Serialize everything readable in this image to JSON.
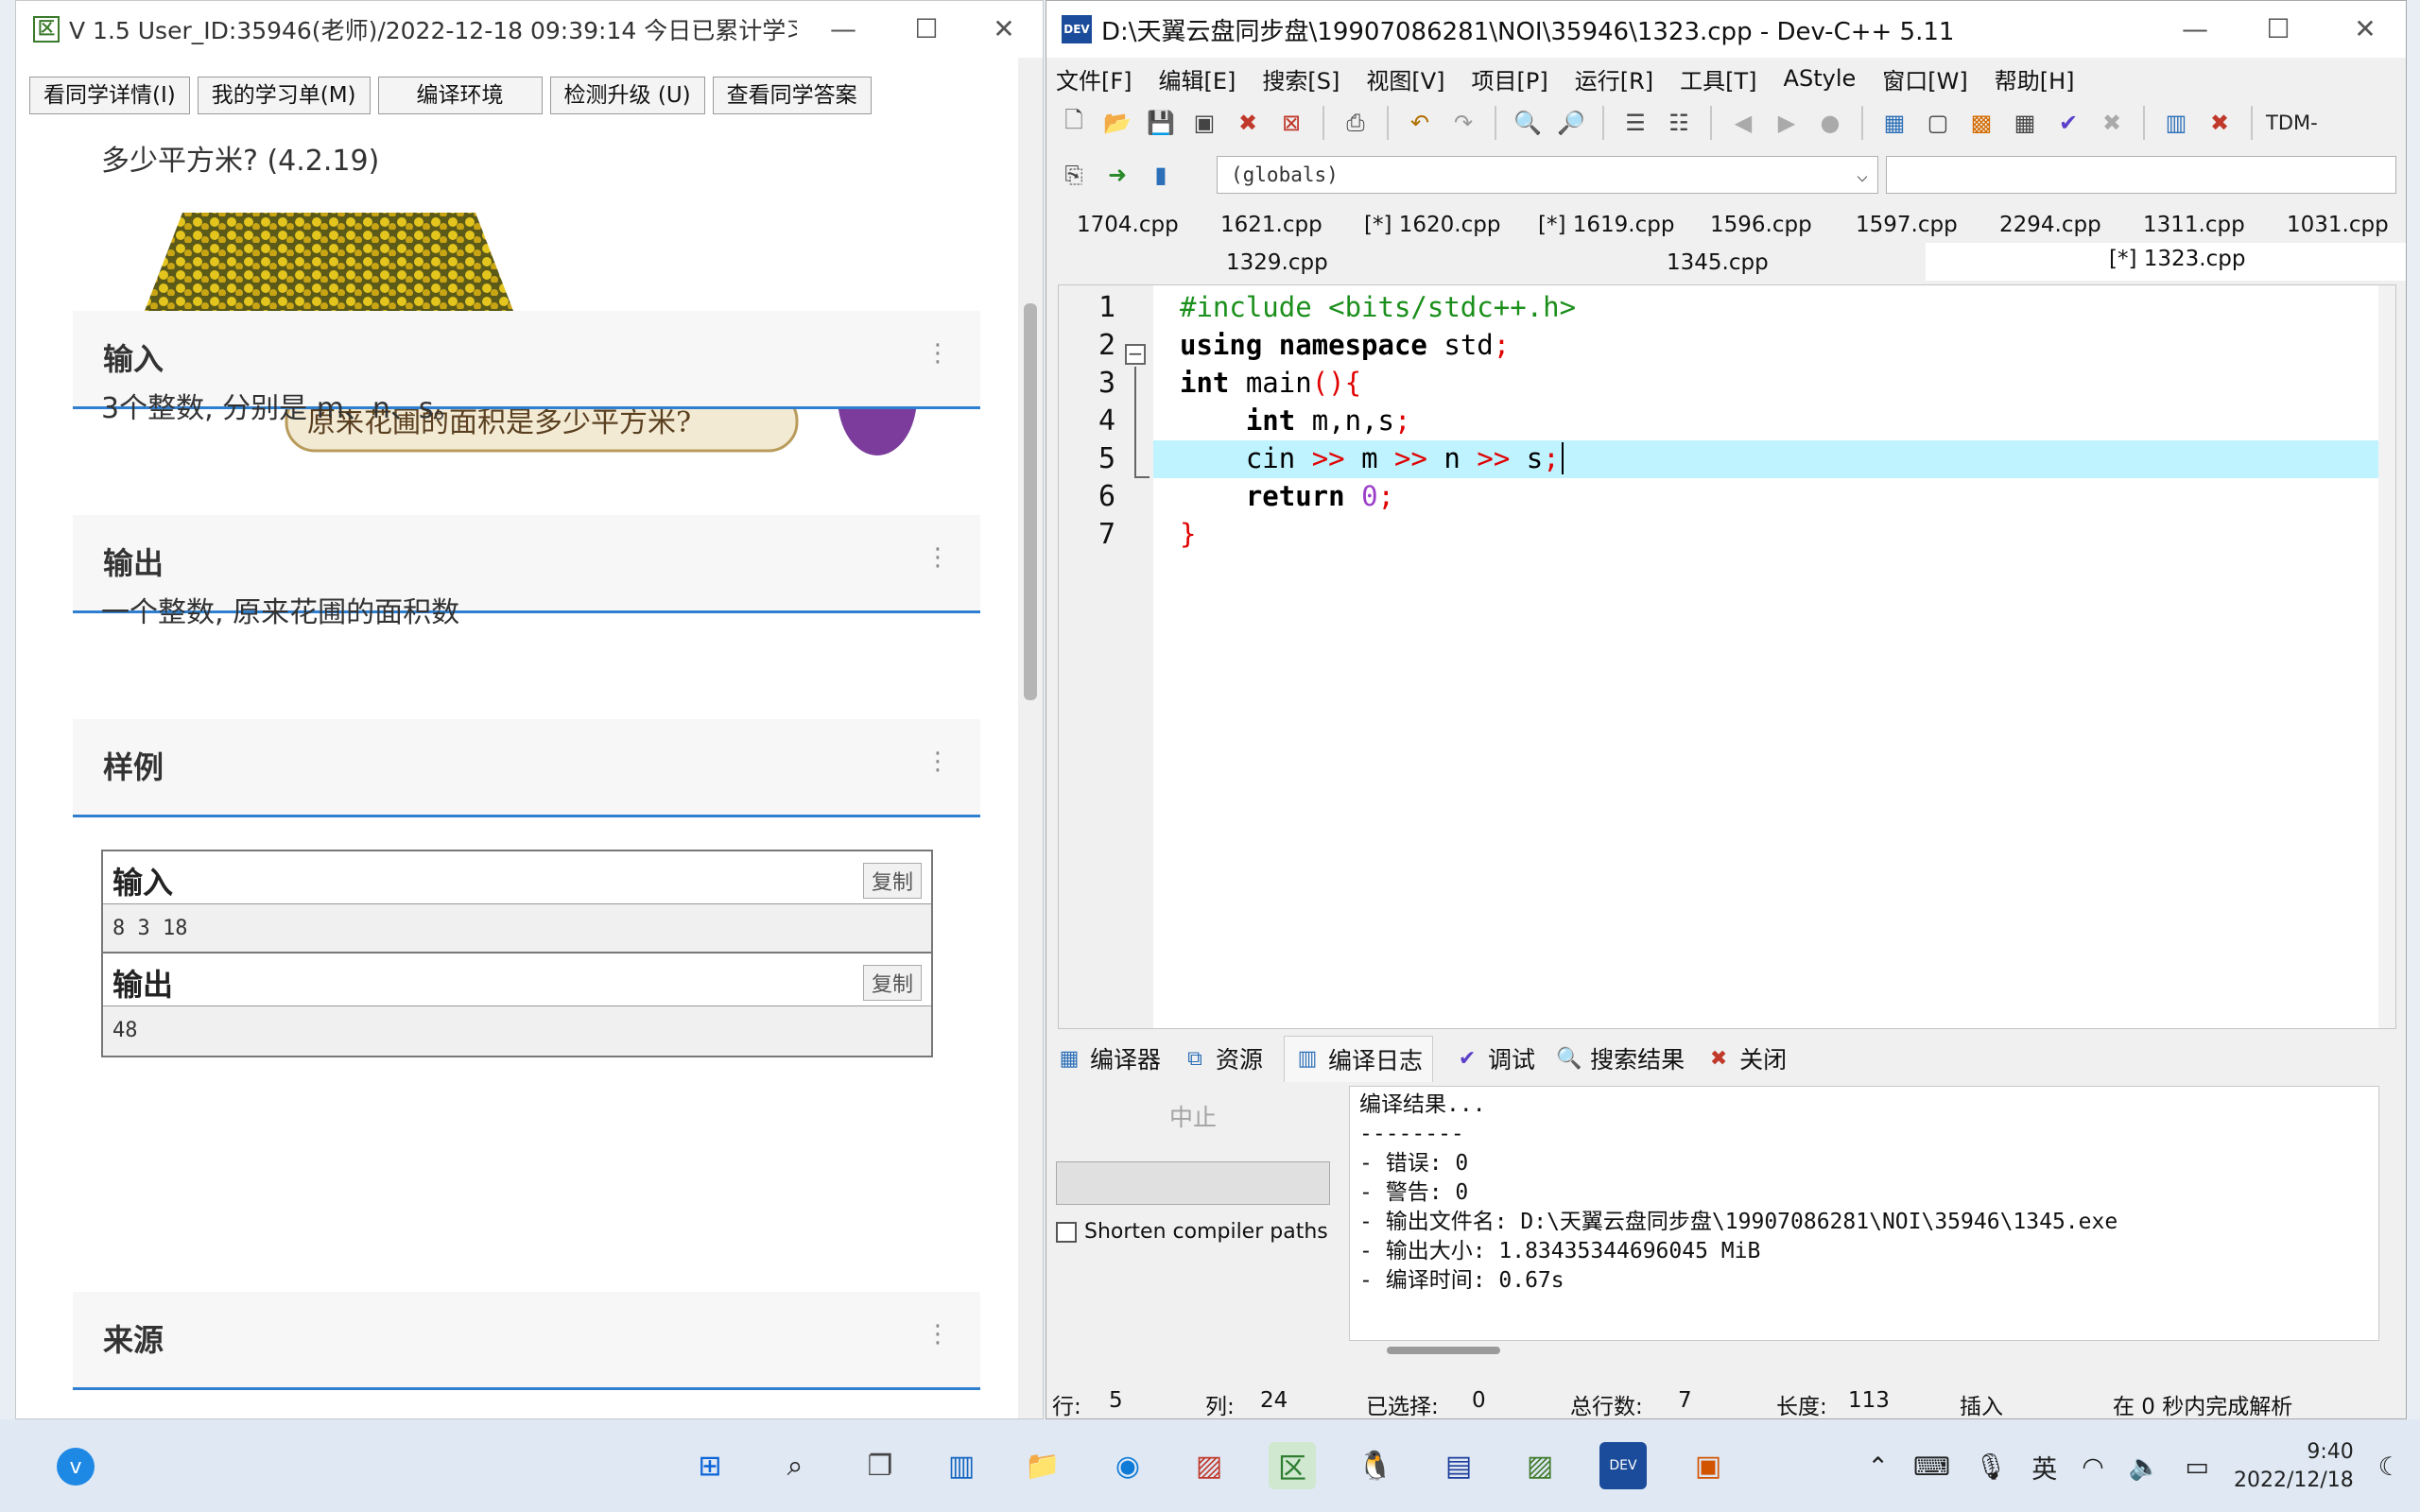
{
  "left_window": {
    "title": "V 1.5 User_ID:35946(老师)/2022-12-18 09:39:14 今日已累计学习：...",
    "toolbar": [
      "看同学详情(I)",
      "我的学习单(M)",
      "编译环境",
      "检测升级 (U)",
      "查看同学答案"
    ],
    "question_tail": "多少平方米? (4.2.19)",
    "caption": "原来花圃的面积是多少平方米?",
    "sections": {
      "input_title": "输入",
      "input_desc": "3个整数, 分别是 m、n、s。",
      "output_title": "输出",
      "output_desc": "一个整数, 原来花圃的面积数",
      "sample_title": "样例",
      "source_title": "来源"
    },
    "sample": {
      "input_label": "输入",
      "input_value": "8 3 18",
      "output_label": "输出",
      "output_value": "48",
      "copy_label": "复制"
    }
  },
  "devcpp": {
    "title": "D:\\天翼云盘同步盘\\19907086281\\NOI\\35946\\1323.cpp - Dev-C++ 5.11",
    "menu": [
      "文件[F]",
      "编辑[E]",
      "搜索[S]",
      "视图[V]",
      "项目[P]",
      "运行[R]",
      "工具[T]",
      "AStyle",
      "窗口[W]",
      "帮助[H]"
    ],
    "toolbar_label": "TDM-",
    "scope": "(globals)",
    "tabs_row1": [
      "1704.cpp",
      "1621.cpp",
      "[*] 1620.cpp",
      "[*] 1619.cpp",
      "1596.cpp",
      "1597.cpp",
      "2294.cpp",
      "1311.cpp",
      "1031.cpp"
    ],
    "tabs_row2": [
      "1329.cpp",
      "1345.cpp",
      "[*] 1323.cpp"
    ],
    "line_numbers": [
      "1",
      "2",
      "3",
      "4",
      "5",
      "6",
      "7"
    ],
    "code": {
      "l1": "#include <bits/stdc++.h>",
      "l2_kw": "using namespace",
      "l2_rest": " std",
      "l3_kw": "int",
      "l3_rest": " main",
      "l4_kw": "int",
      "l4_rest": " m,n,s",
      "l5_a": "cin",
      "l5_b": "m",
      "l5_c": "n",
      "l5_d": "s",
      "l6_kw": "return",
      "l6_num": "0",
      "l7": "}"
    },
    "bottom_tabs": [
      "编译器",
      "资源",
      "编译日志",
      "调试",
      "搜索结果",
      "关闭"
    ],
    "abort": "中止",
    "shorten": "Shorten compiler paths",
    "log": [
      "编译结果...",
      "--------",
      "- 错误: 0",
      "- 警告: 0",
      "- 输出文件名: D:\\天翼云盘同步盘\\19907086281\\NOI\\35946\\1345.exe",
      "- 输出大小: 1.83435344696045 MiB",
      "- 编译时间: 0.67s"
    ],
    "status": {
      "row_label": "行:",
      "row": "5",
      "col_label": "列:",
      "col": "24",
      "sel_label": "已选择:",
      "sel": "0",
      "total_label": "总行数:",
      "total": "7",
      "len_label": "长度:",
      "len": "113",
      "mode": "插入",
      "parse": "在 0 秒内完成解析"
    }
  },
  "taskbar": {
    "ime": "英",
    "time": "9:40",
    "date": "2022/12/18"
  }
}
